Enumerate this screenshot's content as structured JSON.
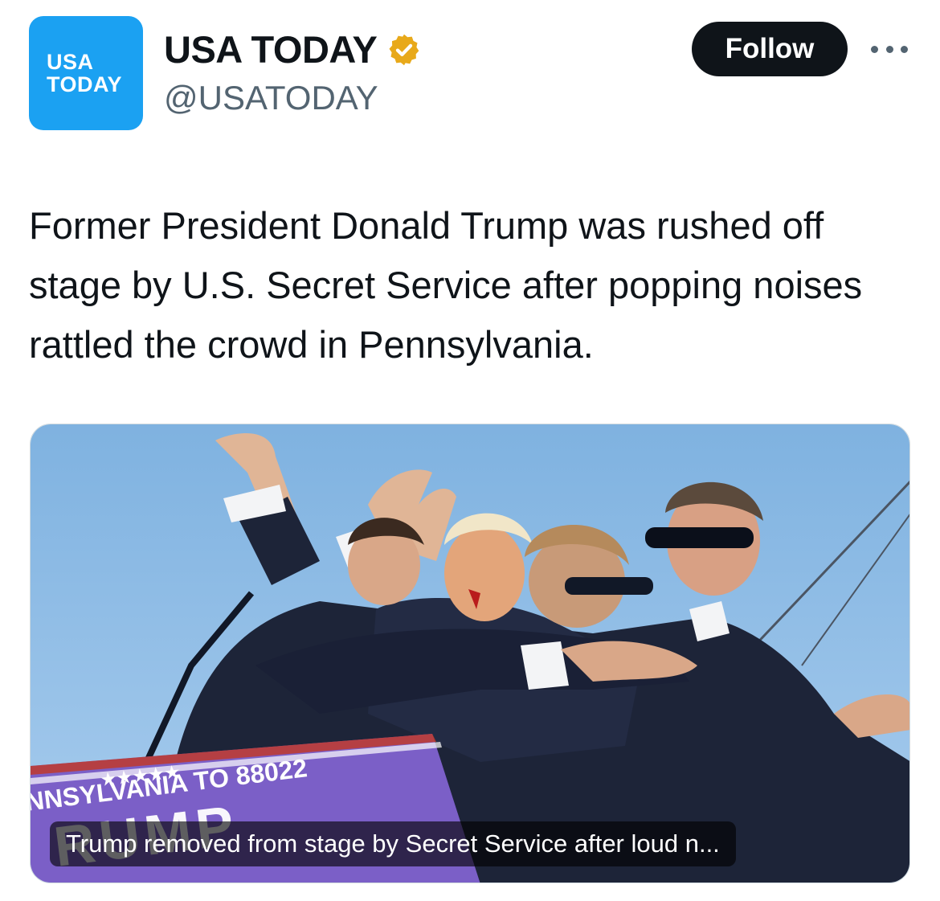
{
  "account": {
    "avatar_line1": "USA",
    "avatar_line2": "TODAY",
    "display_name": "USA TODAY",
    "handle": "@USATODAY",
    "verified_icon": "gold-verified-badge-icon",
    "avatar_color": "#1ba1f2",
    "badge_color": "#e8a91a"
  },
  "actions": {
    "follow_label": "Follow",
    "more_icon": "more-horizontal-icon"
  },
  "tweet": {
    "text": "Former President Donald Trump was rushed off stage by U.S. Secret Service after popping noises rattled the crowd in Pennsylvania."
  },
  "media": {
    "sign_stars": "★★★★★",
    "sign_state": "NNSYLVANIA TO 88022",
    "sign_name": "RUMP",
    "caption": "Trump removed from stage by Secret Service after loud n..."
  }
}
